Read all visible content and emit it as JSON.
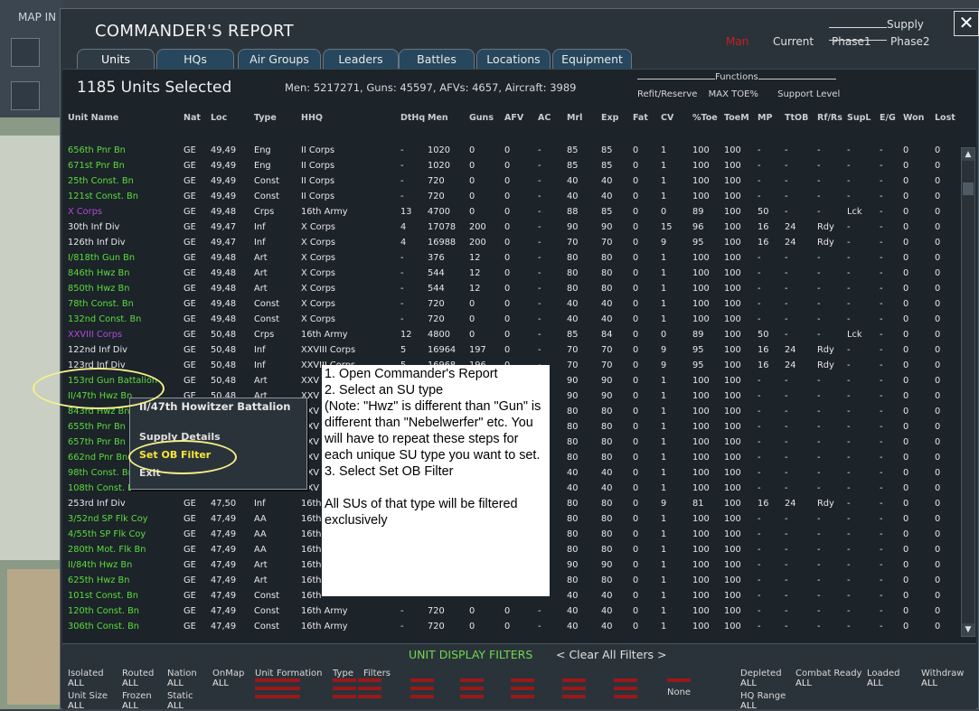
{
  "map": {
    "label": "MAP IN"
  },
  "window": {
    "title": "COMMANDER'S REPORT",
    "close_glyph": "✕",
    "supply": {
      "heading": "Supply",
      "mode_active": "Man",
      "current": "Current",
      "phase1": "Phase1",
      "phase2": "Phase2"
    }
  },
  "tabs": [
    {
      "label": "Units"
    },
    {
      "label": "HQs"
    },
    {
      "label": "Air Groups"
    },
    {
      "label": "Leaders"
    },
    {
      "label": "Battles"
    },
    {
      "label": "Locations"
    },
    {
      "label": "Equipment"
    }
  ],
  "summary": {
    "selected": "1185 Units Selected",
    "totals": "Men: 5217271, Guns: 45597, AFVs: 4657, Aircraft: 3989",
    "functions_label": "Functions",
    "refit": "Refit/Reserve",
    "maxtoe": "MAX TOE%",
    "support": "Support Level"
  },
  "columns": [
    "Unit Name",
    "Nat",
    "Loc",
    "Type",
    "HHQ",
    "DtHq",
    "Men",
    "Guns",
    "AFV",
    "AC",
    "Mrl",
    "Exp",
    "Fat",
    "CV",
    "%Toe",
    "ToeM",
    "MP",
    "TtOB",
    "Rf/Rs",
    "SupL",
    "E/G",
    "Won",
    "Lost"
  ],
  "rows": [
    {
      "c": "green",
      "v": [
        "656th Pnr Bn",
        "GE",
        "49,49",
        "Eng",
        "II Corps",
        "-",
        "1020",
        "0",
        "0",
        "-",
        "85",
        "85",
        "0",
        "1",
        "100",
        "100",
        "-",
        "-",
        "-",
        "-",
        "-",
        "0",
        "0"
      ]
    },
    {
      "c": "green",
      "v": [
        "671st Pnr Bn",
        "GE",
        "49,49",
        "Eng",
        "II Corps",
        "-",
        "1020",
        "0",
        "0",
        "-",
        "85",
        "85",
        "0",
        "1",
        "100",
        "100",
        "-",
        "-",
        "-",
        "-",
        "-",
        "0",
        "0"
      ]
    },
    {
      "c": "green",
      "v": [
        "25th Const. Bn",
        "GE",
        "49,49",
        "Const",
        "II Corps",
        "-",
        "720",
        "0",
        "0",
        "-",
        "40",
        "40",
        "0",
        "1",
        "100",
        "100",
        "-",
        "-",
        "-",
        "-",
        "-",
        "0",
        "0"
      ]
    },
    {
      "c": "green",
      "v": [
        "121st Const. Bn",
        "GE",
        "49,49",
        "Const",
        "II Corps",
        "-",
        "720",
        "0",
        "0",
        "-",
        "40",
        "40",
        "0",
        "1",
        "100",
        "100",
        "-",
        "-",
        "-",
        "-",
        "-",
        "0",
        "0"
      ]
    },
    {
      "c": "purple",
      "v": [
        "X Corps",
        "GE",
        "49,48",
        "Crps",
        "16th Army",
        "13",
        "4700",
        "0",
        "0",
        "-",
        "88",
        "85",
        "0",
        "0",
        "89",
        "100",
        "50",
        "-",
        "-",
        "Lck",
        "-",
        "0",
        "0"
      ]
    },
    {
      "c": "white",
      "v": [
        "30th Inf Div",
        "GE",
        "49,47",
        "Inf",
        "X Corps",
        "4",
        "17078",
        "200",
        "0",
        "-",
        "90",
        "90",
        "0",
        "15",
        "96",
        "100",
        "16",
        "24",
        "Rdy",
        "-",
        "-",
        "0",
        "0"
      ]
    },
    {
      "c": "white",
      "v": [
        "126th Inf Div",
        "GE",
        "49,47",
        "Inf",
        "X Corps",
        "4",
        "16988",
        "200",
        "0",
        "-",
        "70",
        "70",
        "0",
        "9",
        "95",
        "100",
        "16",
        "24",
        "Rdy",
        "-",
        "-",
        "0",
        "0"
      ]
    },
    {
      "c": "green",
      "v": [
        "I/818th Gun Bn",
        "GE",
        "49,48",
        "Art",
        "X Corps",
        "-",
        "376",
        "12",
        "0",
        "-",
        "80",
        "80",
        "0",
        "1",
        "100",
        "100",
        "-",
        "-",
        "-",
        "-",
        "-",
        "0",
        "0"
      ]
    },
    {
      "c": "green",
      "v": [
        "846th Hwz Bn",
        "GE",
        "49,48",
        "Art",
        "X Corps",
        "-",
        "544",
        "12",
        "0",
        "-",
        "80",
        "80",
        "0",
        "1",
        "100",
        "100",
        "-",
        "-",
        "-",
        "-",
        "-",
        "0",
        "0"
      ]
    },
    {
      "c": "green",
      "v": [
        "850th Hwz Bn",
        "GE",
        "49,48",
        "Art",
        "X Corps",
        "-",
        "544",
        "12",
        "0",
        "-",
        "80",
        "80",
        "0",
        "1",
        "100",
        "100",
        "-",
        "-",
        "-",
        "-",
        "-",
        "0",
        "0"
      ]
    },
    {
      "c": "green",
      "v": [
        "78th Const. Bn",
        "GE",
        "49,48",
        "Const",
        "X Corps",
        "-",
        "720",
        "0",
        "0",
        "-",
        "40",
        "40",
        "0",
        "1",
        "100",
        "100",
        "-",
        "-",
        "-",
        "-",
        "-",
        "0",
        "0"
      ]
    },
    {
      "c": "green",
      "v": [
        "132nd Const. Bn",
        "GE",
        "49,48",
        "Const",
        "X Corps",
        "-",
        "720",
        "0",
        "0",
        "-",
        "40",
        "40",
        "0",
        "1",
        "100",
        "100",
        "-",
        "-",
        "-",
        "-",
        "-",
        "0",
        "0"
      ]
    },
    {
      "c": "purple",
      "v": [
        "XXVIII Corps",
        "GE",
        "50,48",
        "Crps",
        "16th Army",
        "12",
        "4800",
        "0",
        "0",
        "-",
        "85",
        "84",
        "0",
        "0",
        "89",
        "100",
        "50",
        "-",
        "-",
        "Lck",
        "-",
        "0",
        "0"
      ]
    },
    {
      "c": "white",
      "v": [
        "122nd Inf Div",
        "GE",
        "50,48",
        "Inf",
        "XXVIII Corps",
        "5",
        "16964",
        "197",
        "0",
        "-",
        "70",
        "70",
        "0",
        "9",
        "95",
        "100",
        "16",
        "24",
        "Rdy",
        "-",
        "-",
        "0",
        "0"
      ]
    },
    {
      "c": "white",
      "v": [
        "123rd Inf Div",
        "GE",
        "50,48",
        "Inf",
        "XXVIII Corps",
        "5",
        "16968",
        "196",
        "0",
        "-",
        "70",
        "70",
        "0",
        "9",
        "95",
        "100",
        "16",
        "24",
        "Rdy",
        "-",
        "-",
        "0",
        "0"
      ]
    },
    {
      "c": "green",
      "v": [
        "153rd Gun Battalion",
        "GE",
        "50,48",
        "Art",
        "XXV",
        "",
        "",
        "",
        "",
        "",
        "90",
        "90",
        "0",
        "1",
        "100",
        "100",
        "-",
        "-",
        "-",
        "-",
        "-",
        "0",
        "0"
      ]
    },
    {
      "c": "green",
      "v": [
        "II/47th Hwz Bn",
        "GE",
        "50,48",
        "Art",
        "XXV",
        "",
        "",
        "",
        "",
        "",
        "90",
        "90",
        "0",
        "1",
        "100",
        "100",
        "-",
        "-",
        "-",
        "-",
        "-",
        "0",
        "0"
      ]
    },
    {
      "c": "green",
      "v": [
        "843rd Hwz Bn",
        "GE",
        "",
        "",
        "XXV",
        "",
        "",
        "",
        "",
        "",
        "80",
        "80",
        "0",
        "1",
        "100",
        "100",
        "-",
        "-",
        "-",
        "-",
        "-",
        "0",
        "0"
      ]
    },
    {
      "c": "green",
      "v": [
        "655th Pnr Bn",
        "GE",
        "",
        "",
        "XXV",
        "",
        "",
        "",
        "",
        "",
        "80",
        "80",
        "0",
        "1",
        "100",
        "100",
        "-",
        "-",
        "-",
        "-",
        "-",
        "0",
        "0"
      ]
    },
    {
      "c": "green",
      "v": [
        "657th Pnr Bn",
        "GE",
        "",
        "",
        "XXV",
        "",
        "",
        "",
        "",
        "",
        "80",
        "80",
        "0",
        "1",
        "100",
        "100",
        "-",
        "-",
        "-",
        "-",
        "-",
        "0",
        "0"
      ]
    },
    {
      "c": "green",
      "v": [
        "662nd Pnr Bn",
        "GE",
        "",
        "",
        "XXV",
        "",
        "",
        "",
        "",
        "",
        "80",
        "80",
        "0",
        "1",
        "100",
        "100",
        "-",
        "-",
        "-",
        "-",
        "-",
        "0",
        "0"
      ]
    },
    {
      "c": "green",
      "v": [
        "98th Const. Bn",
        "GE",
        "",
        "",
        "XXV",
        "",
        "",
        "",
        "",
        "",
        "40",
        "40",
        "0",
        "1",
        "100",
        "100",
        "-",
        "-",
        "-",
        "-",
        "-",
        "0",
        "0"
      ]
    },
    {
      "c": "green",
      "v": [
        "108th Const. Bn",
        "GE",
        "",
        "",
        "XXV",
        "",
        "",
        "",
        "",
        "",
        "40",
        "40",
        "0",
        "1",
        "100",
        "100",
        "-",
        "-",
        "-",
        "-",
        "-",
        "0",
        "0"
      ]
    },
    {
      "c": "white",
      "v": [
        "253rd Inf Div",
        "GE",
        "47,50",
        "Inf",
        "16th",
        "",
        "",
        "",
        "",
        "",
        "80",
        "80",
        "0",
        "9",
        "81",
        "100",
        "16",
        "24",
        "Rdy",
        "-",
        "-",
        "0",
        "0"
      ]
    },
    {
      "c": "green",
      "v": [
        "3/52nd SP Flk Coy",
        "GE",
        "47,49",
        "AA",
        "16th",
        "",
        "",
        "",
        "",
        "",
        "80",
        "80",
        "0",
        "1",
        "100",
        "100",
        "-",
        "-",
        "-",
        "-",
        "-",
        "0",
        "0"
      ]
    },
    {
      "c": "green",
      "v": [
        "4/55th SP Flk Coy",
        "GE",
        "47,49",
        "AA",
        "16th",
        "",
        "",
        "",
        "",
        "",
        "80",
        "80",
        "0",
        "1",
        "100",
        "100",
        "-",
        "-",
        "-",
        "-",
        "-",
        "0",
        "0"
      ]
    },
    {
      "c": "green",
      "v": [
        "280th Mot. Flk Bn",
        "GE",
        "47,49",
        "AA",
        "16th",
        "",
        "",
        "",
        "",
        "",
        "80",
        "80",
        "0",
        "1",
        "100",
        "100",
        "-",
        "-",
        "-",
        "-",
        "-",
        "0",
        "0"
      ]
    },
    {
      "c": "green",
      "v": [
        "II/84th Hwz Bn",
        "GE",
        "47,49",
        "Art",
        "16th",
        "",
        "",
        "",
        "",
        "",
        "90",
        "90",
        "0",
        "1",
        "100",
        "100",
        "-",
        "-",
        "-",
        "-",
        "-",
        "0",
        "0"
      ]
    },
    {
      "c": "green",
      "v": [
        "625th Hwz Bn",
        "GE",
        "47,49",
        "Art",
        "16th",
        "",
        "",
        "",
        "",
        "",
        "80",
        "80",
        "0",
        "1",
        "100",
        "100",
        "-",
        "-",
        "-",
        "-",
        "-",
        "0",
        "0"
      ]
    },
    {
      "c": "green",
      "v": [
        "101st Const. Bn",
        "GE",
        "47,49",
        "Const",
        "16th",
        "",
        "",
        "",
        "",
        "",
        "40",
        "40",
        "0",
        "1",
        "100",
        "100",
        "-",
        "-",
        "-",
        "-",
        "-",
        "0",
        "0"
      ]
    },
    {
      "c": "green",
      "v": [
        "120th Const. Bn",
        "GE",
        "47,49",
        "Const",
        "16th Army",
        "-",
        "720",
        "0",
        "0",
        "-",
        "40",
        "40",
        "0",
        "1",
        "100",
        "100",
        "-",
        "-",
        "-",
        "-",
        "-",
        "0",
        "0"
      ]
    },
    {
      "c": "green",
      "v": [
        "306th Const. Bn",
        "GE",
        "47,49",
        "Const",
        "16th Army",
        "-",
        "720",
        "0",
        "0",
        "-",
        "40",
        "40",
        "0",
        "1",
        "100",
        "100",
        "-",
        "-",
        "-",
        "-",
        "-",
        "0",
        "0"
      ]
    }
  ],
  "context_menu": {
    "title": "II/47th Howitzer Battalion",
    "supply_details": "Supply Details",
    "set_ob_filter": "Set OB Filter",
    "exit": "Exit"
  },
  "note": {
    "lines": [
      "1. Open Commander's Report",
      "2. Select an SU type",
      "(Note: \"Hwz\" is different than \"Gun\" is different than \"Nebelwerfer\" etc. You will have to repeat these steps for each unique SU type you want to set.",
      "3. Select Set OB Filter",
      "",
      "All SUs of that type will be filtered exclusively"
    ]
  },
  "filters": {
    "title": "UNIT DISPLAY FILTERS",
    "clear": "< Clear All Filters >",
    "items": [
      {
        "label": "Isolated",
        "value": "ALL"
      },
      {
        "label": "Routed",
        "value": "ALL"
      },
      {
        "label": "Nation",
        "value": "ALL"
      },
      {
        "label": "OnMap",
        "value": "ALL"
      },
      {
        "label": "Unit Size",
        "value": "ALL"
      },
      {
        "label": "Frozen",
        "value": "ALL"
      },
      {
        "label": "Static",
        "value": "ALL"
      },
      {
        "label": "Unit",
        "value": ""
      },
      {
        "label": "Formation",
        "value": ""
      },
      {
        "label": "Type",
        "value": ""
      },
      {
        "label": "Filters",
        "value": ""
      },
      {
        "label": "Depleted",
        "value": "ALL"
      },
      {
        "label": "Combat Ready",
        "value": "ALL"
      },
      {
        "label": "Loaded",
        "value": "ALL"
      },
      {
        "label": "Withdraw",
        "value": "ALL"
      },
      {
        "label": "HQ Range",
        "value": "ALL"
      },
      {
        "label": "",
        "value": "None"
      }
    ]
  }
}
